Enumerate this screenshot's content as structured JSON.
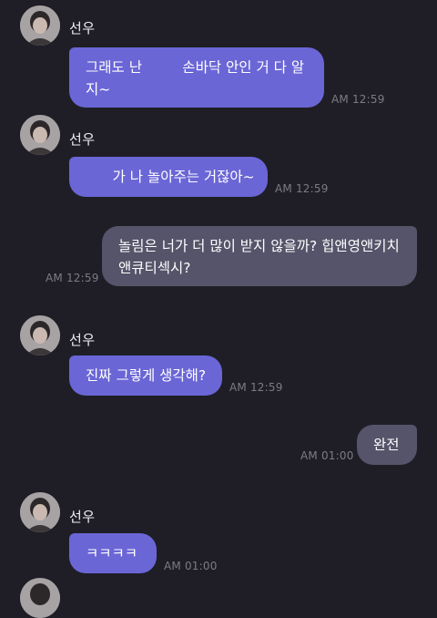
{
  "messages": [
    {
      "sender": "선우",
      "text": "그래도 난         손바닥 안인 거 다 알\n지~",
      "time": "AM 12:59"
    },
    {
      "sender": "선우",
      "text": "      가 나 놀아주는 거잖아~",
      "time": "AM 12:59"
    },
    {
      "text": "놀림은 너가 더 많이 받지 않을까? 힙앤영앤키치\n앤큐티섹시?",
      "time": "AM 12:59"
    },
    {
      "sender": "선우",
      "text": "진짜 그렇게 생각해?",
      "time": "AM 12:59"
    },
    {
      "text": "완전",
      "time": "AM 01:00"
    },
    {
      "sender": "선우",
      "text": "ㅋㅋㅋㅋ",
      "time": "AM 01:00"
    }
  ],
  "colors": {
    "background": "#1f1e26",
    "incoming_bubble": "#6a66d6",
    "outgoing_bubble": "#55546a",
    "timestamp": "#7c7b86"
  }
}
